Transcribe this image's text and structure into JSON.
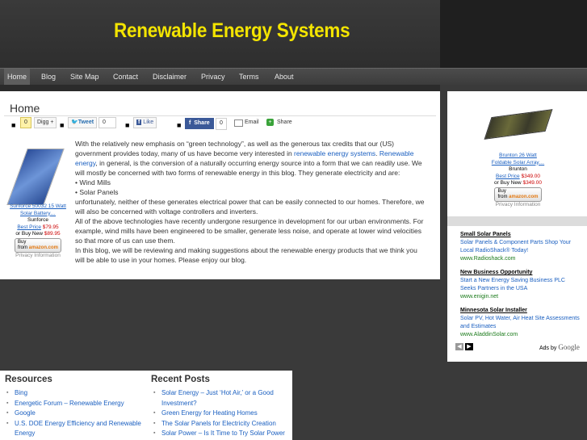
{
  "site": {
    "title": "Renewable Energy Systems"
  },
  "nav": [
    "Home",
    "Blog",
    "Site Map",
    "Contact",
    "Disclaimer",
    "Privacy",
    "Terms",
    "About"
  ],
  "page": {
    "heading": "Home",
    "share": {
      "digg_count": "0",
      "digg_label": "Digg +",
      "tweet_label": "Tweet",
      "tweet_count": "0",
      "like_label": "Like",
      "fb_share_label": "Share",
      "fb_share_count": "0",
      "email_label": "Email",
      "share_label": "Share"
    },
    "article": {
      "p1_a": "With the relatively new emphasis on “green technology”, as well as the generous tax credits that our (US) government provides today, many of us have become very interested in ",
      "p1_link1": "renewable energy systems",
      "p1_b": ". ",
      "p1_link2": "Renewable energy",
      "p1_c": ", in general, is the conversion of a naturally occurring energy source into a form that we can readily use. We will mostly be concerned with two forms of renewable energy in this blog. They generate electricity and are:",
      "list": [
        "• Wind Mills",
        "• Solar Panels"
      ],
      "p2": "unfortunately, neither of these generates electrical power that can be easily connected to our homes. Therefore, we will also be concerned with voltage controllers and inverters.",
      "p3": "All of the above technologies have recently undergone resurgence in development for our urban environments. For example, wind mills have been engineered to be smaller, generate less noise, and operate at lower wind velocities so that more of us can use them.",
      "p4": "In this blog, we will be reviewing and making suggestions about the renewable energy products that we think you will be able to use in your homes. Please enjoy our blog."
    },
    "product_left": {
      "title_line1": "Sunforce 50032 15 Watt",
      "title_line2": "Solar Battery…",
      "brand": "Sunforce",
      "best_price_label": "Best Price",
      "best_price": "$79.95",
      "buy_new_label": "or Buy New",
      "buy_new": "$89.95",
      "buy_button_top": "Buy",
      "buy_button_mid": "from",
      "buy_button_brand": "amazon.com",
      "privacy": "Privacy Information"
    }
  },
  "sidebar": {
    "product": {
      "title_line1": "Brunton 26 Watt",
      "title_line2": "Foldable Solar Array…",
      "brand": "Brunton",
      "best_price_label": "Best Price",
      "best_price": "$349.00",
      "buy_new_label": "or Buy New",
      "buy_new": "$349.00",
      "buy_button_top": "Buy",
      "buy_button_mid": "from",
      "buy_button_brand": "amazon.com",
      "privacy": "Privacy Information"
    },
    "ads": [
      {
        "headline": "Small Solar Panels",
        "desc": "Solar Panels & Component Parts Shop Your Local RadioShack® Today!",
        "url": "www.Radioshack.com"
      },
      {
        "headline": "New Business Opportunity",
        "desc": "Start a New Energy Saving Business PLC Seeks Partners in the USA",
        "url": "www.enigin.net"
      },
      {
        "headline": "Minnesota Solar Installer",
        "desc": "Solar PV, Hot Water, Air Heat Site Assessments and Estimates",
        "url": "www.AladdinSolar.com"
      }
    ],
    "ads_by": "Ads by",
    "ads_brand": "Google"
  },
  "footer": {
    "resources_title": "Resources",
    "resources": [
      "Bing",
      "Energetic Forum – Renewable Energy",
      "Google",
      "U.S. DOE Energy Efficiency and Renewable Energy"
    ],
    "recent_title": "Recent Posts",
    "recent": [
      "Solar Energy – Just ‘Hot Air,’ or a Good Investment?",
      "Green Energy for Heating Homes",
      "The Solar Panels for Electricity Creation",
      "Solar Power – Is It Time to Try Solar Power"
    ]
  }
}
